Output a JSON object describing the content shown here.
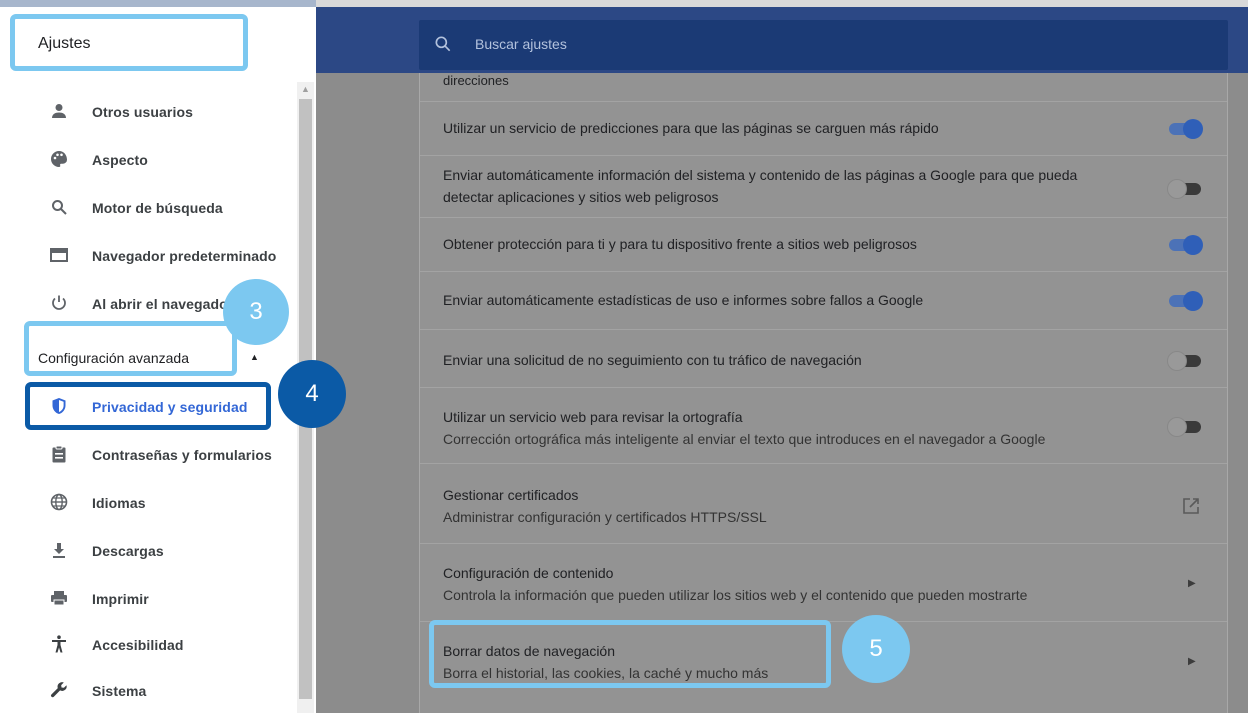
{
  "sidebar": {
    "title": "Ajustes",
    "items": [
      {
        "label": "Otros usuarios",
        "icon": "person-icon"
      },
      {
        "label": "Aspecto",
        "icon": "palette-icon"
      },
      {
        "label": "Motor de búsqueda",
        "icon": "search-icon"
      },
      {
        "label": "Navegador predeterminado",
        "icon": "browser-window-icon"
      },
      {
        "label": "Al abrir el navegador",
        "icon": "power-icon"
      }
    ],
    "advanced_label": "Configuración avanzada",
    "advanced_items": [
      {
        "label": "Privacidad y seguridad",
        "icon": "shield-icon",
        "active": true
      },
      {
        "label": "Contraseñas y formularios",
        "icon": "clipboard-icon"
      },
      {
        "label": "Idiomas",
        "icon": "globe-icon"
      },
      {
        "label": "Descargas",
        "icon": "download-icon"
      },
      {
        "label": "Imprimir",
        "icon": "printer-icon"
      },
      {
        "label": "Accesibilidad",
        "icon": "accessibility-icon"
      },
      {
        "label": "Sistema",
        "icon": "wrench-icon"
      }
    ]
  },
  "search": {
    "placeholder": "Buscar ajustes"
  },
  "settings": {
    "partial_row": "direcciones",
    "rows": [
      {
        "title": "Utilizar un servicio de predicciones para que las páginas se carguen más rápido",
        "toggle": "on"
      },
      {
        "title": "Enviar automáticamente información del sistema y contenido de las páginas a Google para que pueda detectar aplicaciones y sitios web peligrosos",
        "toggle": "off"
      },
      {
        "title": "Obtener protección para ti y para tu dispositivo frente a sitios web peligrosos",
        "toggle": "on"
      },
      {
        "title": "Enviar automáticamente estadísticas de uso e informes sobre fallos a Google",
        "toggle": "on"
      },
      {
        "title": "Enviar una solicitud de no seguimiento con tu tráfico de navegación",
        "toggle": "off"
      },
      {
        "title": "Utilizar un servicio web para revisar la ortografía",
        "subtitle": "Corrección ortográfica más inteligente al enviar el texto que introduces en el navegador a Google",
        "toggle": "off"
      },
      {
        "title": "Gestionar certificados",
        "subtitle": "Administrar configuración y certificados HTTPS/SSL",
        "action": "external-link-icon"
      },
      {
        "title": "Configuración de contenido",
        "subtitle": "Controla la información que pueden utilizar los sitios web y el contenido que pueden mostrarte",
        "action": "chevron-right-icon"
      },
      {
        "title": "Borrar datos de navegación",
        "subtitle": "Borra el historial, las cookies, la caché y mucho más",
        "action": "chevron-right-icon"
      }
    ]
  },
  "steps": {
    "three": "3",
    "four": "4",
    "five": "5"
  },
  "colors": {
    "header": "#2c4885",
    "accent": "#3367d6",
    "highlight_light": "#7cc8f0",
    "highlight_dark": "#0b5aa6"
  }
}
